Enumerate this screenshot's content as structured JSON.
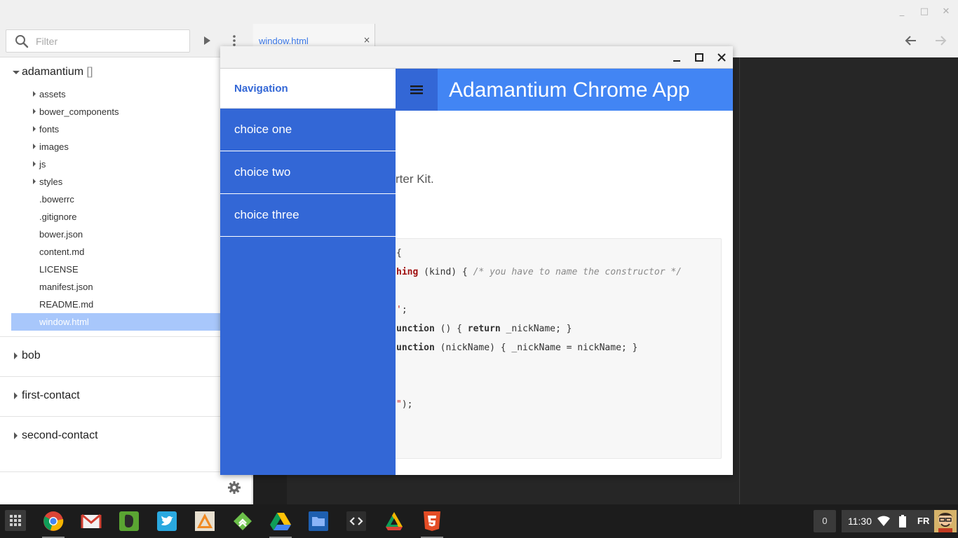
{
  "window": {
    "minimize_glyph": "_",
    "maximize_glyph": "□",
    "close_glyph": "✕"
  },
  "sidebar": {
    "filter_placeholder": "Filter",
    "projects": [
      {
        "name": "adamantium",
        "suffix": " []"
      },
      {
        "name": "bob"
      },
      {
        "name": "first-contact"
      },
      {
        "name": "second-contact"
      }
    ],
    "folders": [
      "assets",
      "bower_components",
      "fonts",
      "images",
      "js",
      "styles"
    ],
    "files": [
      ".bowerrc",
      ".gitignore",
      "bower.json",
      "content.md",
      "LICENSE",
      "manifest.json",
      "README.md",
      "window.html"
    ],
    "selected_file": "window.html"
  },
  "tabs": [
    {
      "label": "window.html",
      "close": "×"
    }
  ],
  "app": {
    "title": "Adamantium Chrome App",
    "drawer_title": "Navigation",
    "menu": [
      "choice one",
      "choice two",
      "choice three"
    ],
    "intro_fragment": "rter Kit."
  },
  "code_lines": [
    {
      "parts": [
        {
          "t": "{",
          "c": ""
        }
      ]
    },
    {
      "parts": [
        {
          "t": "hing",
          "c": "fn"
        },
        {
          "t": " (kind) { ",
          "c": ""
        },
        {
          "t": "/* you have to name the constructor */",
          "c": "cm"
        }
      ]
    },
    {
      "parts": []
    },
    {
      "parts": [
        {
          "t": "'",
          "c": "str"
        },
        {
          "t": ";",
          "c": ""
        }
      ]
    },
    {
      "parts": [
        {
          "t": "unction",
          "c": "kw"
        },
        {
          "t": " () { ",
          "c": ""
        },
        {
          "t": "return",
          "c": "kw"
        },
        {
          "t": " _nickName; }",
          "c": ""
        }
      ]
    },
    {
      "parts": [
        {
          "t": "unction",
          "c": "kw"
        },
        {
          "t": " (nickName) { _nickName = nickName; }",
          "c": ""
        }
      ]
    },
    {
      "parts": []
    },
    {
      "parts": []
    },
    {
      "parts": [
        {
          "t": "\"",
          "c": "str"
        },
        {
          "t": ");",
          "c": ""
        }
      ]
    }
  ],
  "shelf": {
    "apps": [
      "chrome",
      "gmail",
      "evernote",
      "twitter",
      "caret",
      "feedly",
      "drive",
      "files",
      "dev-editor",
      "drive-app",
      "html5"
    ],
    "notification_count": "0",
    "time": "11:30",
    "language": "FR"
  },
  "colors": {
    "accent": "#4285f4",
    "drawer": "#3367d6",
    "selection": "#a8c7fb",
    "editor_bg": "#262626"
  }
}
